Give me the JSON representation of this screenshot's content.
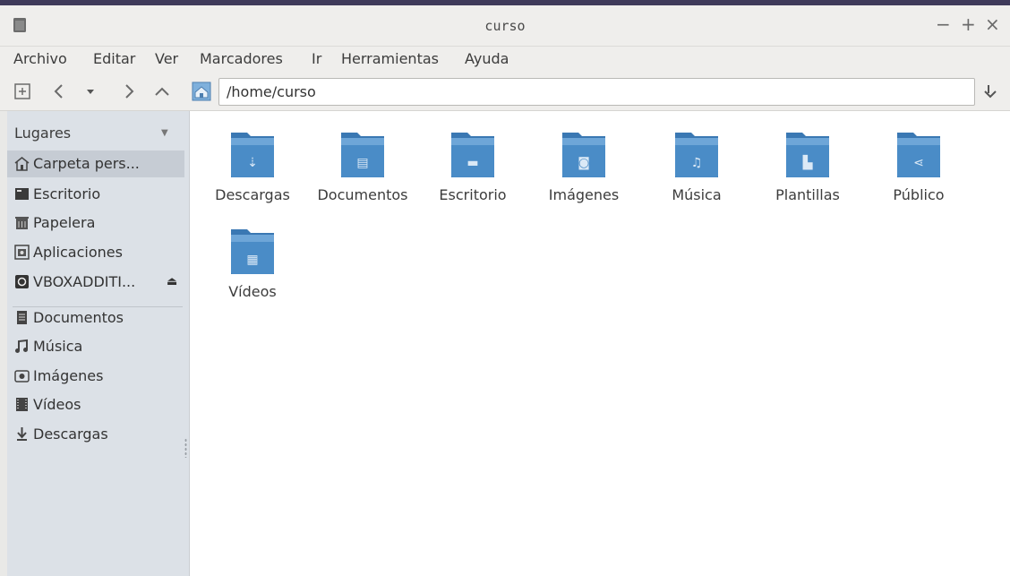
{
  "window": {
    "title": "curso",
    "minimize_label": "−",
    "maximize_label": "+",
    "close_label": "×"
  },
  "menu": [
    "Archivo",
    "Editar",
    "Ver",
    "Marcadores",
    "Ir",
    "Herramientas",
    "Ayuda"
  ],
  "toolbar": {
    "path": "/home/curso",
    "buttons": [
      "new-tab-icon",
      "back-icon",
      "history-dropdown-icon",
      "forward-icon",
      "up-icon",
      "home-icon",
      "go-icon"
    ]
  },
  "sidebar": {
    "header": "Lugares",
    "places": [
      {
        "label": "Carpeta pers...",
        "icon": "home-icon",
        "selected": true
      },
      {
        "label": "Escritorio",
        "icon": "desktop-icon"
      },
      {
        "label": "Papelera",
        "icon": "trash-icon"
      },
      {
        "label": "Aplicaciones",
        "icon": "applications-icon"
      },
      {
        "label": "VBOXADDITI...",
        "icon": "disc-icon",
        "eject": "⏏"
      }
    ],
    "bookmarks": [
      {
        "label": "Documentos",
        "icon": "document-icon"
      },
      {
        "label": "Música",
        "icon": "music-icon"
      },
      {
        "label": "Imágenes",
        "icon": "camera-icon"
      },
      {
        "label": "Vídeos",
        "icon": "film-icon"
      },
      {
        "label": "Descargas",
        "icon": "download-icon"
      }
    ]
  },
  "folders": [
    {
      "label": "Descargas",
      "glyph": "⇣"
    },
    {
      "label": "Documentos",
      "glyph": "▤"
    },
    {
      "label": "Escritorio",
      "glyph": "▬"
    },
    {
      "label": "Imágenes",
      "glyph": "◙"
    },
    {
      "label": "Música",
      "glyph": "♫"
    },
    {
      "label": "Plantillas",
      "glyph": "▙"
    },
    {
      "label": "Público",
      "glyph": "⋖"
    },
    {
      "label": "Vídeos",
      "glyph": "▦"
    }
  ],
  "colors": {
    "accent_frame": "#3f3a5a",
    "chrome": "#efeeec",
    "sidebar": "#dce1e7",
    "folder_blue": "#4a8cc7"
  }
}
